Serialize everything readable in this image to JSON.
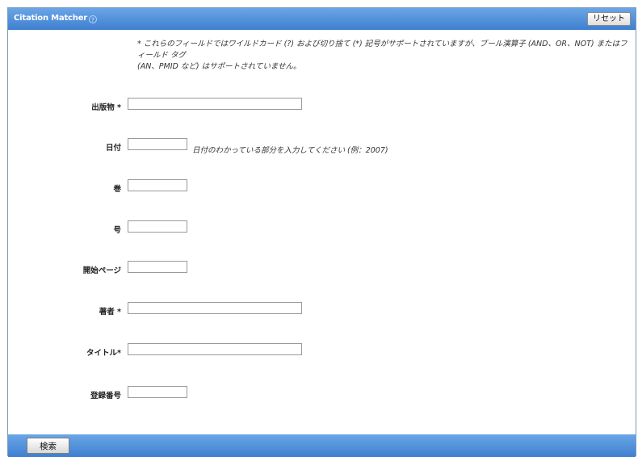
{
  "header": {
    "title": "Citation Matcher",
    "help_symbol": "?",
    "reset_label": "リセット"
  },
  "note_lines": [
    "* これらのフィールドではワイルドカード (?) および切り捨て (*) 記号がサポートされていますが、ブール演算子 (AND、OR、NOT) またはフィールド タグ",
    "(AN、PMID など) はサポートされていません。"
  ],
  "fields": {
    "publication": {
      "label": "出版物 *",
      "value": ""
    },
    "date": {
      "label": "日付",
      "value": "",
      "hint": "日付のわかっている部分を入力してください (例：2007)"
    },
    "volume": {
      "label": "巻",
      "value": ""
    },
    "issue": {
      "label": "号",
      "value": ""
    },
    "start_page": {
      "label": "開始ページ",
      "value": ""
    },
    "author": {
      "label": "著者 *",
      "value": ""
    },
    "title": {
      "label": "タイトル*",
      "value": ""
    },
    "accession_number": {
      "label": "登録番号",
      "value": ""
    }
  },
  "footer": {
    "search_label": "検索"
  }
}
